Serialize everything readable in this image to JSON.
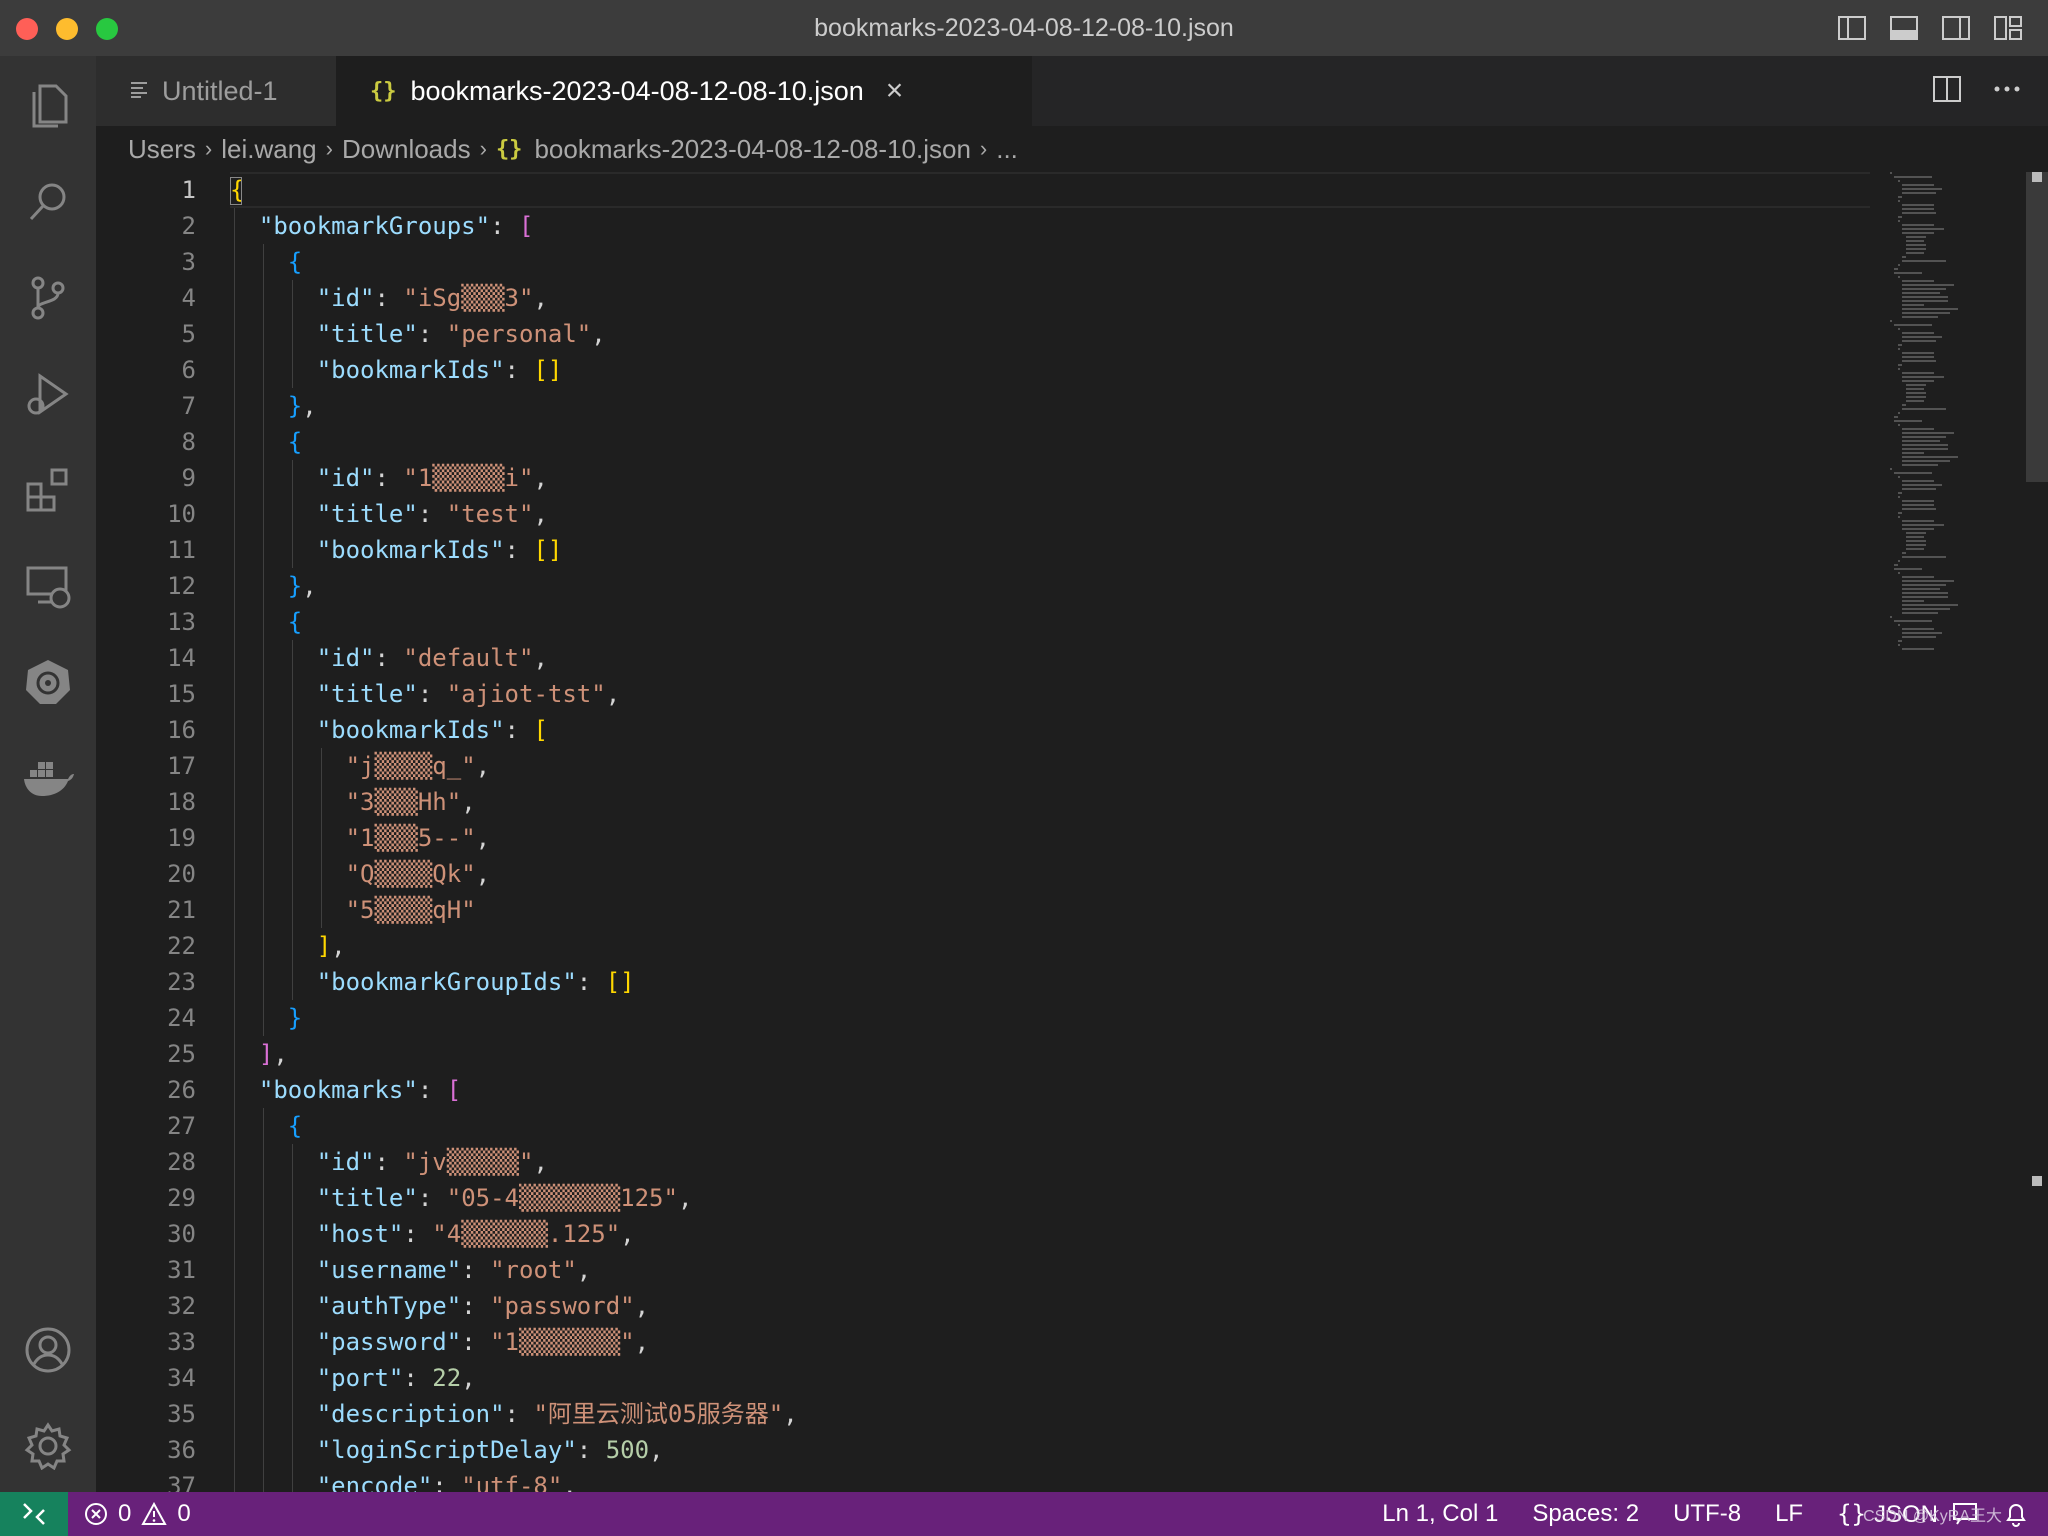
{
  "window": {
    "title": "bookmarks-2023-04-08-12-08-10.json"
  },
  "tabs": [
    {
      "label": "Untitled-1",
      "icon": "text-lines-icon"
    },
    {
      "label": "bookmarks-2023-04-08-12-08-10.json",
      "icon": "json-braces-icon",
      "icon_glyph": "{}"
    }
  ],
  "breadcrumb": {
    "items": [
      "Users",
      "lei.wang",
      "Downloads"
    ],
    "file_icon": "{}",
    "file": "bookmarks-2023-04-08-12-08-10.json",
    "tail": "..."
  },
  "editor": {
    "lines": [
      [
        [
          "b1",
          "{"
        ]
      ],
      [
        [
          "k",
          "\"bookmarkGroups\""
        ],
        [
          "p",
          ": "
        ],
        [
          "b2",
          "["
        ]
      ],
      [
        [
          "b3",
          "{"
        ]
      ],
      [
        [
          "k",
          "\"id\""
        ],
        [
          "p",
          ": "
        ],
        [
          "s",
          "\"iSg▒▒▒3\""
        ],
        [
          "p",
          ","
        ]
      ],
      [
        [
          "k",
          "\"title\""
        ],
        [
          "p",
          ": "
        ],
        [
          "s",
          "\"personal\""
        ],
        [
          "p",
          ","
        ]
      ],
      [
        [
          "k",
          "\"bookmarkIds\""
        ],
        [
          "p",
          ": "
        ],
        [
          "b1",
          "[]"
        ]
      ],
      [
        [
          "b3",
          "}"
        ],
        [
          "p",
          ","
        ]
      ],
      [
        [
          "b3",
          "{"
        ]
      ],
      [
        [
          "k",
          "\"id\""
        ],
        [
          "p",
          ": "
        ],
        [
          "s",
          "\"1▒▒▒▒▒i\""
        ],
        [
          "p",
          ","
        ]
      ],
      [
        [
          "k",
          "\"title\""
        ],
        [
          "p",
          ": "
        ],
        [
          "s",
          "\"test\""
        ],
        [
          "p",
          ","
        ]
      ],
      [
        [
          "k",
          "\"bookmarkIds\""
        ],
        [
          "p",
          ": "
        ],
        [
          "b1",
          "[]"
        ]
      ],
      [
        [
          "b3",
          "}"
        ],
        [
          "p",
          ","
        ]
      ],
      [
        [
          "b3",
          "{"
        ]
      ],
      [
        [
          "k",
          "\"id\""
        ],
        [
          "p",
          ": "
        ],
        [
          "s",
          "\"default\""
        ],
        [
          "p",
          ","
        ]
      ],
      [
        [
          "k",
          "\"title\""
        ],
        [
          "p",
          ": "
        ],
        [
          "s",
          "\"ajiot-tst\""
        ],
        [
          "p",
          ","
        ]
      ],
      [
        [
          "k",
          "\"bookmarkIds\""
        ],
        [
          "p",
          ": "
        ],
        [
          "b1",
          "["
        ]
      ],
      [
        [
          "s",
          "\"j▒▒▒▒q_\""
        ],
        [
          "p",
          ","
        ]
      ],
      [
        [
          "s",
          "\"3▒▒▒Hh\""
        ],
        [
          "p",
          ","
        ]
      ],
      [
        [
          "s",
          "\"1▒▒▒5--\""
        ],
        [
          "p",
          ","
        ]
      ],
      [
        [
          "s",
          "\"Q▒▒▒▒Qk\""
        ],
        [
          "p",
          ","
        ]
      ],
      [
        [
          "s",
          "\"5▒▒▒▒qH\""
        ]
      ],
      [
        [
          "b1",
          "]"
        ],
        [
          "p",
          ","
        ]
      ],
      [
        [
          "k",
          "\"bookmarkGroupIds\""
        ],
        [
          "p",
          ": "
        ],
        [
          "b1",
          "[]"
        ]
      ],
      [
        [
          "b3",
          "}"
        ]
      ],
      [
        [
          "b2",
          "]"
        ],
        [
          "p",
          ","
        ]
      ],
      [
        [
          "k",
          "\"bookmarks\""
        ],
        [
          "p",
          ": "
        ],
        [
          "b2",
          "["
        ]
      ],
      [
        [
          "b3",
          "{"
        ]
      ],
      [
        [
          "k",
          "\"id\""
        ],
        [
          "p",
          ": "
        ],
        [
          "s",
          "\"jv▒▒▒▒▒\""
        ],
        [
          "p",
          ","
        ]
      ],
      [
        [
          "k",
          "\"title\""
        ],
        [
          "p",
          ": "
        ],
        [
          "s",
          "\"05-4▒▒▒▒▒▒▒125\""
        ],
        [
          "p",
          ","
        ]
      ],
      [
        [
          "k",
          "\"host\""
        ],
        [
          "p",
          ": "
        ],
        [
          "s",
          "\"4▒▒▒▒▒▒.125\""
        ],
        [
          "p",
          ","
        ]
      ],
      [
        [
          "k",
          "\"username\""
        ],
        [
          "p",
          ": "
        ],
        [
          "s",
          "\"root\""
        ],
        [
          "p",
          ","
        ]
      ],
      [
        [
          "k",
          "\"authType\""
        ],
        [
          "p",
          ": "
        ],
        [
          "s",
          "\"password\""
        ],
        [
          "p",
          ","
        ]
      ],
      [
        [
          "k",
          "\"password\""
        ],
        [
          "p",
          ": "
        ],
        [
          "s",
          "\"1▒▒▒▒▒▒▒\""
        ],
        [
          "p",
          ","
        ]
      ],
      [
        [
          "k",
          "\"port\""
        ],
        [
          "p",
          ": "
        ],
        [
          "n",
          "22"
        ],
        [
          "p",
          ","
        ]
      ],
      [
        [
          "k",
          "\"description\""
        ],
        [
          "p",
          ": "
        ],
        [
          "s",
          "\"阿里云测试05服务器\""
        ],
        [
          "p",
          ","
        ]
      ],
      [
        [
          "k",
          "\"loginScriptDelay\""
        ],
        [
          "p",
          ": "
        ],
        [
          "n",
          "500"
        ],
        [
          "p",
          ","
        ]
      ],
      [
        [
          "k",
          "\"encode\""
        ],
        [
          "p",
          ": "
        ],
        [
          "s",
          "\"utf-8\""
        ],
        [
          "p",
          ","
        ]
      ]
    ]
  },
  "status": {
    "errors": "0",
    "warnings": "0",
    "position": "Ln 1, Col 1",
    "spaces": "Spaces: 2",
    "encoding": "UTF-8",
    "eol": "LF",
    "language_icon": "{}",
    "language": "JSON",
    "watermark": "CSDN @KyRA王大"
  },
  "colors": {
    "titlebar": "#3c3c3c",
    "activitybar": "#333333",
    "editor_bg": "#1e1e1e",
    "statusbar": "#68217a",
    "remote": "#16825d"
  }
}
